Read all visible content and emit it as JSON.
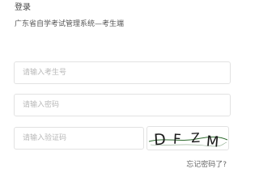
{
  "header": {
    "title": "登录",
    "system_name": "广东省自学考试管理系统—考生端"
  },
  "form": {
    "exam_number": {
      "value": "",
      "placeholder": "请输入考生号"
    },
    "password": {
      "value": "",
      "placeholder": "请输入密码"
    },
    "captcha": {
      "value": "",
      "placeholder": "请输入验证码"
    },
    "captcha_image_text": "DFZM",
    "forgot_password": "忘记密码了?"
  }
}
